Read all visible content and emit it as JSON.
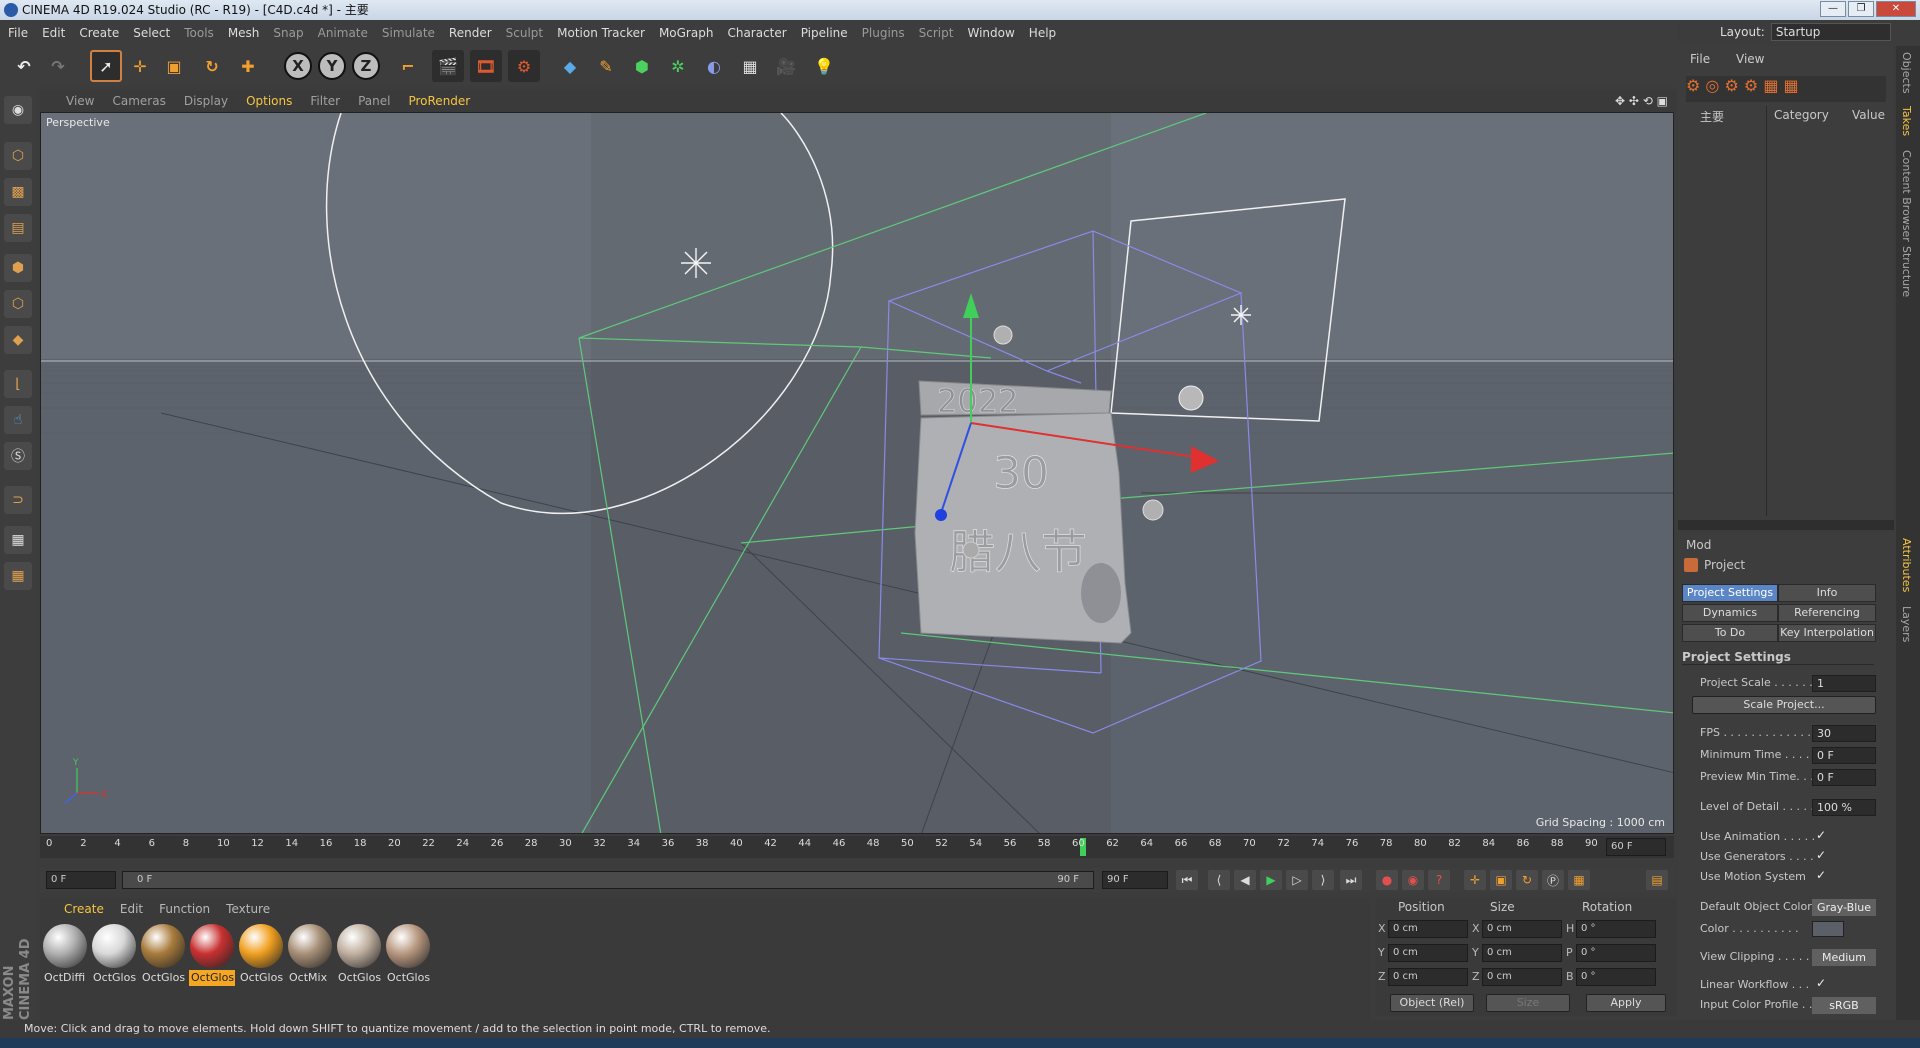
{
  "window": {
    "title": "CINEMA 4D R19.024 Studio (RC - R19) - [C4D.c4d *] - 主要"
  },
  "menu": [
    "File",
    "Edit",
    "Create",
    "Select",
    "Tools",
    "Mesh",
    "Snap",
    "Animate",
    "Simulate",
    "Render",
    "Sculpt",
    "Motion Tracker",
    "MoGraph",
    "Character",
    "Pipeline",
    "Plugins",
    "Script",
    "Window",
    "Help"
  ],
  "layout": {
    "label": "Layout:",
    "value": "Startup"
  },
  "toolbar": {
    "axes": [
      "X",
      "Y",
      "Z"
    ]
  },
  "viewport": {
    "menu": [
      "View",
      "Cameras",
      "Display",
      "Options",
      "Filter",
      "Panel",
      "ProRender"
    ],
    "active_menu": "Options",
    "label": "Perspective",
    "grid_spacing": "Grid Spacing : 1000 cm",
    "scene_text": {
      "year": "2022",
      "day": "30",
      "festival": "腊八节"
    }
  },
  "timeline": {
    "ticks": [
      "0",
      "2",
      "4",
      "6",
      "8",
      "10",
      "12",
      "14",
      "16",
      "18",
      "20",
      "22",
      "24",
      "26",
      "28",
      "30",
      "32",
      "34",
      "36",
      "38",
      "40",
      "42",
      "44",
      "46",
      "48",
      "50",
      "52",
      "54",
      "56",
      "58",
      "60",
      "62",
      "64",
      "66",
      "68",
      "70",
      "72",
      "74",
      "76",
      "78",
      "80",
      "82",
      "84",
      "86",
      "88",
      "90"
    ],
    "current_frame": "60",
    "end_field": "60 F"
  },
  "playbar": {
    "start": "0 F",
    "range_start": "0 F",
    "range_end": "90 F",
    "end": "90 F"
  },
  "materials": {
    "menu": [
      "Create",
      "Edit",
      "Function",
      "Texture"
    ],
    "active_menu": "Create",
    "items": [
      {
        "label": "OctDiffi",
        "color": "#b0b0b0",
        "selected": false
      },
      {
        "label": "OctGlos",
        "color": "#d8d8d8",
        "selected": false
      },
      {
        "label": "OctGlos",
        "color": "#a87b3c",
        "selected": false
      },
      {
        "label": "OctGlos",
        "color": "#c83030",
        "selected": true
      },
      {
        "label": "OctGlos",
        "color": "#f0a020",
        "selected": false
      },
      {
        "label": "OctMix",
        "color": "#a89078",
        "selected": false
      },
      {
        "label": "OctGlos",
        "color": "#c0b0a0",
        "selected": false
      },
      {
        "label": "OctGlos",
        "color": "#b89880",
        "selected": false
      }
    ],
    "brand": "MAXON CINEMA 4D"
  },
  "coordinates": {
    "headers": [
      "Position",
      "Size",
      "Rotation"
    ],
    "rows": [
      {
        "pos_axis": "X",
        "pos": "0 cm",
        "size_axis": "X",
        "size": "0 cm",
        "rot_axis": "H",
        "rot": "0 °"
      },
      {
        "pos_axis": "Y",
        "pos": "0 cm",
        "size_axis": "Y",
        "size": "0 cm",
        "rot_axis": "P",
        "rot": "0 °"
      },
      {
        "pos_axis": "Z",
        "pos": "0 cm",
        "size_axis": "Z",
        "size": "0 cm",
        "rot_axis": "B",
        "rot": "0 °"
      }
    ],
    "mode": "Object (Rel)",
    "size_mode": "Size",
    "apply": "Apply"
  },
  "objects_panel": {
    "menu": [
      "File",
      "View"
    ],
    "tree_root": "主要",
    "col_category": "Category",
    "col_value": "Value"
  },
  "side_tabs": [
    "Objects",
    "Takes",
    "Content Browser",
    "Structure",
    "Attributes",
    "Layers"
  ],
  "attributes": {
    "mode": "Mod",
    "title": "Project",
    "tabs": [
      "Project Settings",
      "Info",
      "Dynamics",
      "Referencing",
      "To Do",
      "Key Interpolation"
    ],
    "section": "Project Settings",
    "project_scale_label": "Project Scale . . . . . .",
    "project_scale": "1",
    "scale_btn": "Scale Project...",
    "fps_label": "FPS . . . . . . . . . . . . . .",
    "fps": "30",
    "min_time_label": "Minimum Time . . . .",
    "min_time": "0 F",
    "preview_min_label": "Preview Min Time. . .",
    "preview_min": "0 F",
    "lod_label": "Level of Detail . . . . .",
    "lod": "100 %",
    "use_animation": "Use Animation . . . . .",
    "use_generators": "Use Generators . . . .",
    "use_motion": "Use Motion System",
    "default_color_label": "Default Object Color",
    "default_color": "Gray-Blue",
    "color_label": "Color . . . . . . . . . .",
    "view_clipping_label": "View Clipping . . . . . .",
    "view_clipping": "Medium",
    "linear_workflow": "Linear Workflow . . .",
    "input_profile_label": "Input Color Profile . . .",
    "input_profile": "sRGB",
    "check": "✓"
  },
  "status": "Move: Click and drag to move elements. Hold down SHIFT to quantize movement / add to the selection in point mode, CTRL to remove."
}
